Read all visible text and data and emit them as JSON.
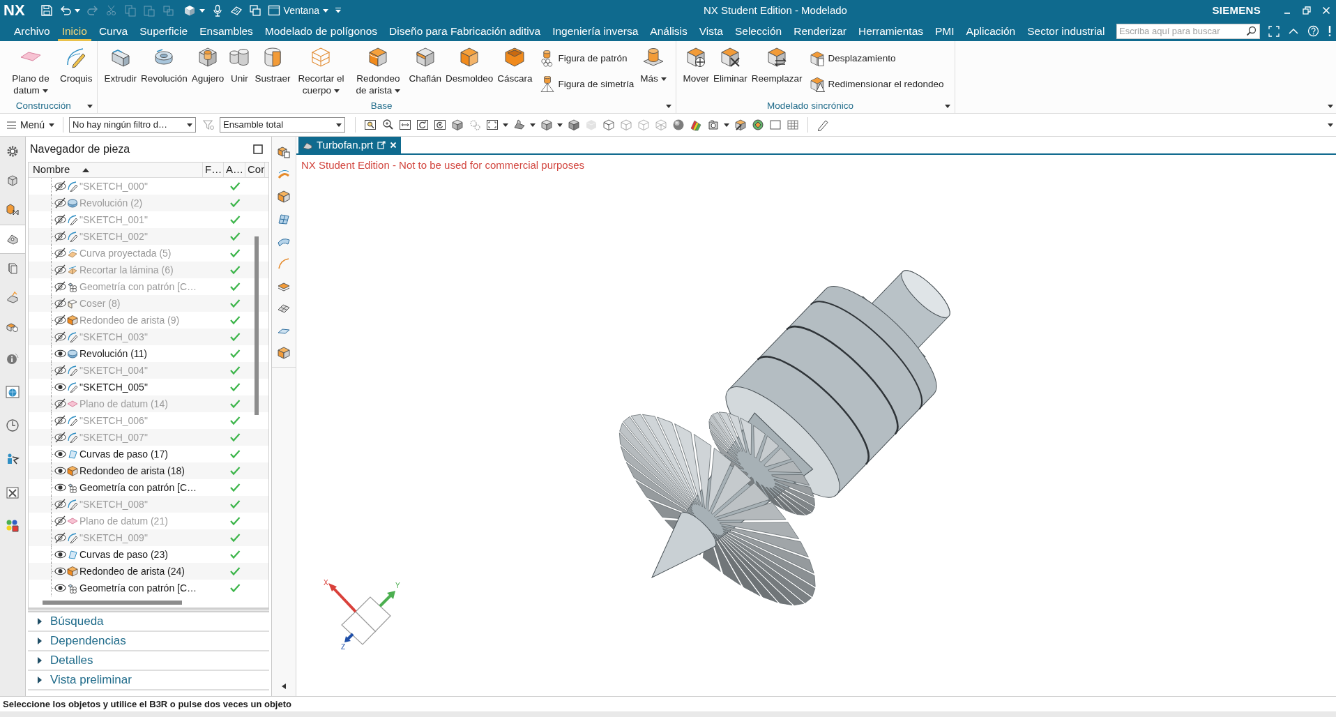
{
  "title_bar": {
    "logo": "NX",
    "window_menu": "Ventana",
    "title": "NX Student Edition - Modelado",
    "brand": "SIEMENS"
  },
  "menu_tabs": [
    {
      "label": "Archivo",
      "selected": false
    },
    {
      "label": "Inicio",
      "selected": true
    },
    {
      "label": "Curva",
      "selected": false
    },
    {
      "label": "Superficie",
      "selected": false
    },
    {
      "label": "Ensambles",
      "selected": false
    },
    {
      "label": "Modelado de polígonos",
      "selected": false
    },
    {
      "label": "Diseño para Fabricación aditiva",
      "selected": false
    },
    {
      "label": "Ingeniería inversa",
      "selected": false
    },
    {
      "label": "Análisis",
      "selected": false
    },
    {
      "label": "Vista",
      "selected": false
    },
    {
      "label": "Selección",
      "selected": false
    },
    {
      "label": "Renderizar",
      "selected": false
    },
    {
      "label": "Herramientas",
      "selected": false
    },
    {
      "label": "PMI",
      "selected": false
    },
    {
      "label": "Aplicación",
      "selected": false
    },
    {
      "label": "Sector industrial",
      "selected": false
    }
  ],
  "search": {
    "placeholder": "Escriba aquí para buscar"
  },
  "ribbon": {
    "groups": [
      {
        "label": "Construcción",
        "items": [
          {
            "label": "Plano de datum",
            "kind": "large",
            "dropdown": true
          },
          {
            "label": "Croquis",
            "kind": "large",
            "dropdown": false
          }
        ]
      },
      {
        "label": "Base",
        "items": [
          {
            "label": "Extrudir",
            "kind": "large",
            "dropdown": false
          },
          {
            "label": "Revolución",
            "kind": "large",
            "dropdown": false
          },
          {
            "label": "Agujero",
            "kind": "large",
            "dropdown": false
          },
          {
            "label": "Unir",
            "kind": "large",
            "dropdown": false
          },
          {
            "label": "Sustraer",
            "kind": "large",
            "dropdown": false
          },
          {
            "label": "Recortar el cuerpo",
            "kind": "large",
            "dropdown": true
          },
          {
            "label": "Redondeo de arista",
            "kind": "large",
            "dropdown": true
          },
          {
            "label": "Chaflán",
            "kind": "large",
            "dropdown": false
          },
          {
            "label": "Desmoldeo",
            "kind": "large",
            "dropdown": false
          },
          {
            "label": "Cáscara",
            "kind": "large",
            "dropdown": false
          },
          {
            "label": "Figura de patrón",
            "kind": "small",
            "dropdown": false
          },
          {
            "label": "Figura de simetría",
            "kind": "small",
            "dropdown": false
          },
          {
            "label": "Más",
            "kind": "large",
            "dropdown": true
          }
        ]
      },
      {
        "label": "Modelado sincrónico",
        "items": [
          {
            "label": "Mover",
            "kind": "large",
            "dropdown": false
          },
          {
            "label": "Eliminar",
            "kind": "large",
            "dropdown": false
          },
          {
            "label": "Reemplazar",
            "kind": "large",
            "dropdown": false
          },
          {
            "label": "Desplazamiento",
            "kind": "small",
            "dropdown": false
          },
          {
            "label": "Redimensionar el redondeo",
            "kind": "small",
            "dropdown": false
          }
        ]
      }
    ]
  },
  "toolbar": {
    "menu": "Menú",
    "selection_filter": "No hay ningún filtro d…",
    "scope": "Ensamble total"
  },
  "resource_bar": [
    {
      "selected": false
    },
    {
      "selected": false
    },
    {
      "selected": false
    },
    {
      "selected": true
    },
    {
      "selected": false
    },
    {
      "selected": false
    },
    {
      "selected": false
    },
    {
      "selected": false
    },
    {
      "selected": false
    },
    {
      "selected": false
    },
    {
      "selected": false
    },
    {
      "selected": false
    },
    {
      "selected": false
    }
  ],
  "part_navigator": {
    "title": "Navegador de pieza",
    "columns": [
      "Nombre",
      "F…",
      "A…",
      "Cor"
    ],
    "rows": [
      {
        "name": "\"SKETCH_000\"",
        "kind": "sketch",
        "visible": false,
        "up_to_date": true
      },
      {
        "name": "Revolución (2)",
        "kind": "revolve",
        "visible": false,
        "up_to_date": true
      },
      {
        "name": "\"SKETCH_001\"",
        "kind": "sketch",
        "visible": false,
        "up_to_date": true
      },
      {
        "name": "\"SKETCH_002\"",
        "kind": "sketch",
        "visible": false,
        "up_to_date": true
      },
      {
        "name": "Curva proyectada (5)",
        "kind": "projected_curve",
        "visible": false,
        "up_to_date": true
      },
      {
        "name": "Recortar la lámina (6)",
        "kind": "trim_sheet",
        "visible": false,
        "up_to_date": true
      },
      {
        "name": "Geometría con patrón [C…",
        "kind": "pattern",
        "visible": false,
        "up_to_date": true
      },
      {
        "name": "Coser (8)",
        "kind": "sew",
        "visible": false,
        "up_to_date": true
      },
      {
        "name": "Redondeo de arista (9)",
        "kind": "edge_blend",
        "visible": false,
        "up_to_date": true
      },
      {
        "name": "\"SKETCH_003\"",
        "kind": "sketch",
        "visible": false,
        "up_to_date": true
      },
      {
        "name": "Revolución (11)",
        "kind": "revolve",
        "visible": true,
        "up_to_date": true
      },
      {
        "name": "\"SKETCH_004\"",
        "kind": "sketch",
        "visible": false,
        "up_to_date": true
      },
      {
        "name": "\"SKETCH_005\"",
        "kind": "sketch",
        "visible": true,
        "up_to_date": true
      },
      {
        "name": "Plano de datum (14)",
        "kind": "datum_plane",
        "visible": false,
        "up_to_date": true
      },
      {
        "name": "\"SKETCH_006\"",
        "kind": "sketch",
        "visible": false,
        "up_to_date": true
      },
      {
        "name": "\"SKETCH_007\"",
        "kind": "sketch",
        "visible": false,
        "up_to_date": true
      },
      {
        "name": "Curvas de paso (17)",
        "kind": "through_curves",
        "visible": true,
        "up_to_date": true
      },
      {
        "name": "Redondeo de arista (18)",
        "kind": "edge_blend",
        "visible": true,
        "up_to_date": true
      },
      {
        "name": "Geometría con patrón [C…",
        "kind": "pattern",
        "visible": true,
        "up_to_date": true
      },
      {
        "name": "\"SKETCH_008\"",
        "kind": "sketch",
        "visible": false,
        "up_to_date": true
      },
      {
        "name": "Plano de datum (21)",
        "kind": "datum_plane",
        "visible": false,
        "up_to_date": true
      },
      {
        "name": "\"SKETCH_009\"",
        "kind": "sketch",
        "visible": false,
        "up_to_date": true
      },
      {
        "name": "Curvas de paso (23)",
        "kind": "through_curves",
        "visible": true,
        "up_to_date": true
      },
      {
        "name": "Redondeo de arista (24)",
        "kind": "edge_blend",
        "visible": true,
        "up_to_date": true
      },
      {
        "name": "Geometría con patrón [C…",
        "kind": "pattern",
        "visible": true,
        "up_to_date": true
      }
    ]
  },
  "panels": [
    {
      "label": "Búsqueda",
      "expanded": false
    },
    {
      "label": "Dependencias",
      "expanded": false
    },
    {
      "label": "Detalles",
      "expanded": false
    },
    {
      "label": "Vista preliminar",
      "expanded": false
    }
  ],
  "document_tab": {
    "label": "Turbofan.prt",
    "selected": true
  },
  "viewport": {
    "notice": "NX Student Edition - Not to be used for commercial purposes",
    "triad": [
      {
        "label": "X",
        "color": "#d9403a"
      },
      {
        "label": "Y",
        "color": "#4caf50"
      },
      {
        "label": "Z",
        "color": "#1f4fa8"
      }
    ]
  },
  "status_bar": "Seleccione los objetos y utilice el B3R o pulse dos veces un objeto"
}
